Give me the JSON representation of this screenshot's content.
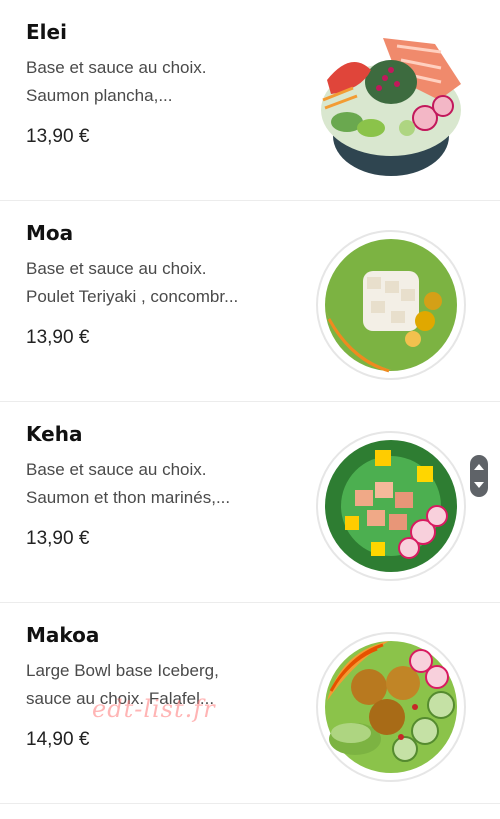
{
  "menu": {
    "items": [
      {
        "name": "Elei",
        "desc_line1": "Base et sauce au choix.",
        "desc_line2": "Saumon plancha,...",
        "price": "13,90 €"
      },
      {
        "name": "Moa",
        "desc_line1": "Base et sauce au choix.",
        "desc_line2": "Poulet Teriyaki , concombr...",
        "price": "13,90 €"
      },
      {
        "name": "Keha",
        "desc_line1": "Base et sauce au choix.",
        "desc_line2": "Saumon et thon marinés,...",
        "price": "13,90 €"
      },
      {
        "name": "Makoa",
        "desc_line1": "Large Bowl base Iceberg,",
        "desc_line2": "sauce au choix. Falafel...",
        "price": "14,90 €"
      }
    ]
  },
  "watermark": {
    "text": "edt-list.fr"
  },
  "icons": {
    "scroll": "scroll-handle-icon",
    "dish": "food-bowl-image"
  },
  "colors": {
    "text_primary": "#111111",
    "text_secondary": "#4a4a4a",
    "divider": "#ececec",
    "scroll_handle": "#5f6368"
  }
}
